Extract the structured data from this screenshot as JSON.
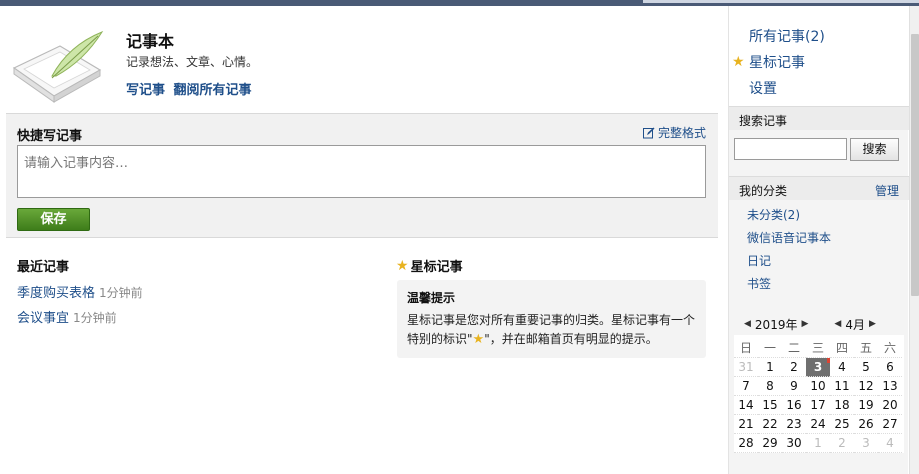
{
  "hero": {
    "title": "记事本",
    "subtitle": "记录想法、文章、心情。",
    "write_link": "写记事",
    "browse_link": "翻阅所有记事"
  },
  "quick": {
    "title": "快捷写记事",
    "full_format": "完整格式",
    "placeholder": "请输入记事内容…",
    "save_label": "保存"
  },
  "recent": {
    "title": "最近记事",
    "items": [
      {
        "title": "季度购买表格",
        "time": "1分钟前"
      },
      {
        "title": "会议事宜",
        "time": "1分钟前"
      }
    ]
  },
  "starred": {
    "title": "星标记事",
    "tip_title": "温馨提示",
    "tip_line1": "星标记事是您对所有重要记事的归类。星标记事有一个",
    "tip_line2a": "特别的标识\"",
    "tip_line2b": "\"，并在邮箱首页有明显的提示。"
  },
  "sidebar": {
    "all_notes": "所有记事(2)",
    "starred_notes": "星标记事",
    "settings": "设置",
    "search_label": "搜索记事",
    "search_button": "搜索",
    "categories_label": "我的分类",
    "manage": "管理",
    "categories": [
      "未分类(2)",
      "微信语音记事本",
      "日记",
      "书签"
    ]
  },
  "calendar": {
    "year": "2019年",
    "month": "4月",
    "weekdays": [
      "日",
      "一",
      "二",
      "三",
      "四",
      "五",
      "六"
    ],
    "today": "3",
    "weeks": [
      [
        "31",
        "1",
        "2",
        "3",
        "4",
        "5",
        "6"
      ],
      [
        "7",
        "8",
        "9",
        "10",
        "11",
        "12",
        "13"
      ],
      [
        "14",
        "15",
        "16",
        "17",
        "18",
        "19",
        "20"
      ],
      [
        "21",
        "22",
        "23",
        "24",
        "25",
        "26",
        "27"
      ],
      [
        "28",
        "29",
        "30",
        "1",
        "2",
        "3",
        "4"
      ]
    ]
  },
  "colors": {
    "link": "#1f4f8a",
    "save": "#4e8e25",
    "star": "#e8b320"
  }
}
